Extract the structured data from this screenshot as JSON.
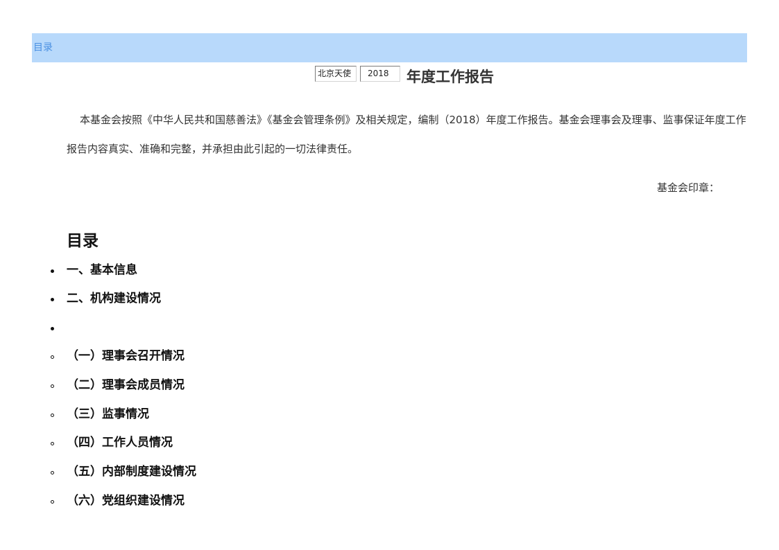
{
  "toc_bar": {
    "label": "目录"
  },
  "title": {
    "org_value": "北京天使",
    "year_value": "2018",
    "suffix": "年度工作报告"
  },
  "intro": "本基金会按照《中华人民共和国慈善法》《基金会管理条例》及相关规定，编制（2018）年度工作报告。基金会理事会及理事、监事保证年度工作报告内容真实、准确和完整，并承担由此引起的一切法律责任。",
  "seal_label": "基金会印章：",
  "toc": {
    "heading": "目录",
    "items": [
      {
        "bullet": "disc",
        "label": "一、基本信息"
      },
      {
        "bullet": "disc",
        "label": "二、机构建设情况"
      },
      {
        "bullet": "disc",
        "label": ""
      },
      {
        "bullet": "circle",
        "label": "（一）理事会召开情况"
      },
      {
        "bullet": "circle",
        "label": "（二）理事会成员情况"
      },
      {
        "bullet": "circle",
        "label": "（三）监事情况"
      },
      {
        "bullet": "circle",
        "label": "（四）工作人员情况"
      },
      {
        "bullet": "circle",
        "label": "（五）内部制度建设情况"
      },
      {
        "bullet": "circle",
        "label": "（六）党组织建设情况"
      }
    ]
  }
}
